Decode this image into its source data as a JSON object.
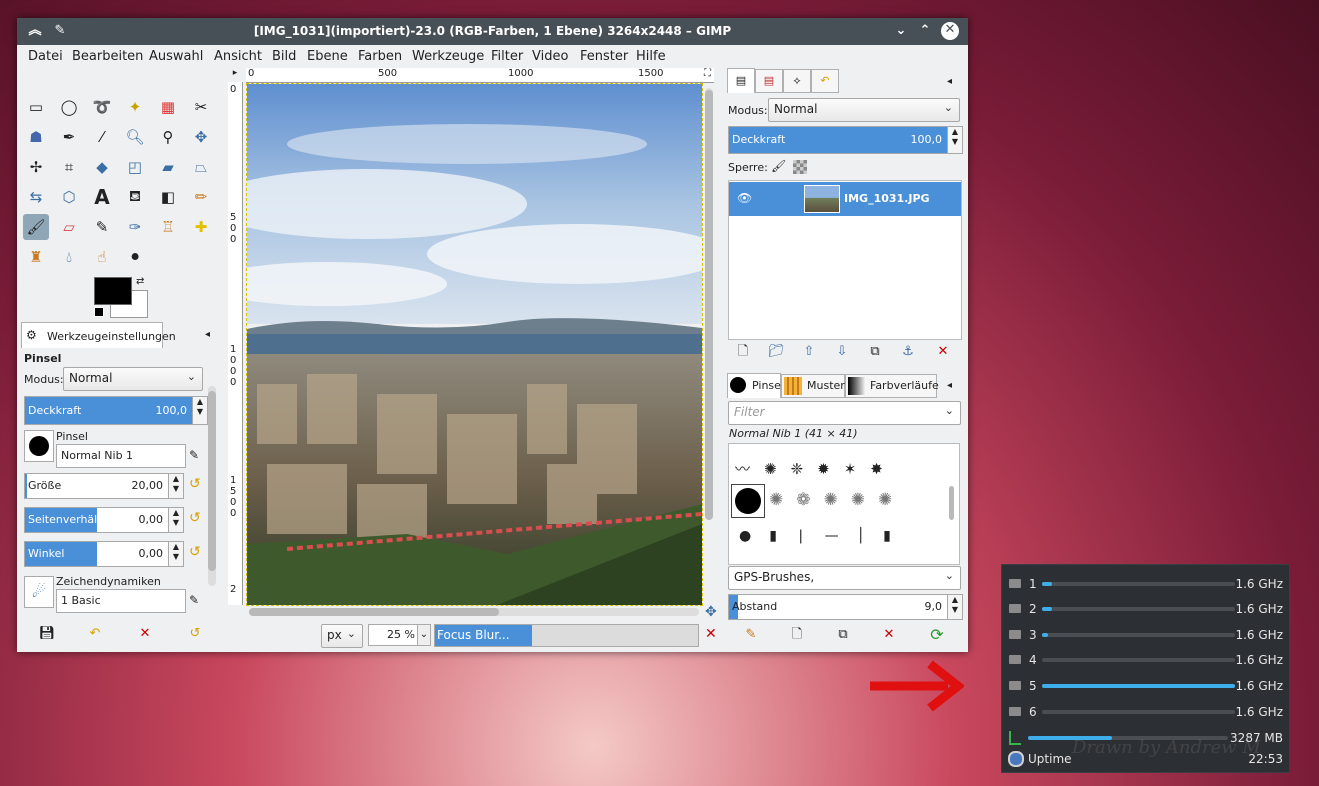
{
  "window": {
    "title": "[IMG_1031](importiert)-23.0 (RGB-Farben, 1 Ebene) 3264x2448 – GIMP"
  },
  "menu": [
    "Datei",
    "Bearbeiten",
    "Auswahl",
    "Ansicht",
    "Bild",
    "Ebene",
    "Farben",
    "Werkzeuge",
    "Filter",
    "Video",
    "Fenster",
    "Hilfe"
  ],
  "tool_options": {
    "tab_label": "Werkzeugeinstellungen",
    "tool_name": "Pinsel",
    "mode_label": "Modus:",
    "mode_value": "Normal",
    "opacity_label": "Deckkraft",
    "opacity_value": "100,0",
    "brush_label": "Pinsel",
    "brush_value": "Normal Nib 1",
    "size_label": "Größe",
    "size_value": "20,00",
    "aspect_label": "Seitenverhältnis",
    "aspect_value": "0,00",
    "angle_label": "Winkel",
    "angle_value": "0,00",
    "dynamics_label": "Zeichendynamiken",
    "dynamics_value": "1 Basic"
  },
  "rulers": {
    "h_ticks": [
      "0",
      "500",
      "1000",
      "1500"
    ],
    "v_ticks": [
      "0",
      "500",
      "1000",
      "1500",
      "2"
    ]
  },
  "status": {
    "unit": "px",
    "zoom": "25 %",
    "progress_label": "Focus Blur...",
    "progress": 0.37
  },
  "layers": {
    "mode_label": "Modus:",
    "mode_value": "Normal",
    "opacity_label": "Deckkraft",
    "opacity_value": "100,0",
    "lock_label": "Sperre:",
    "layer_name": "IMG_1031.JPG"
  },
  "brushes": {
    "tabs": [
      "Pinsel",
      "Muster",
      "Farbverläufe"
    ],
    "filter_placeholder": "Filter",
    "selected_brush": "Normal Nib 1 (41 × 41)",
    "tag_value": "GPS-Brushes,",
    "spacing_label": "Abstand",
    "spacing_value": "9,0"
  },
  "cpu_widget": {
    "cores": [
      {
        "label": "1",
        "freq": "1.6 GHz",
        "load": 0.05
      },
      {
        "label": "2",
        "freq": "1.6 GHz",
        "load": 0.05
      },
      {
        "label": "3",
        "freq": "1.6 GHz",
        "load": 0.03
      },
      {
        "label": "4",
        "freq": "1.6 GHz",
        "load": 0.0
      },
      {
        "label": "5",
        "freq": "1.6 GHz",
        "load": 1.0
      },
      {
        "label": "6",
        "freq": "1.6 GHz",
        "load": 0.0
      }
    ],
    "memory": {
      "value": "3287 MB",
      "load": 0.42
    },
    "uptime_label": "Uptime",
    "uptime_value": "22:53"
  },
  "watermark": "Drawn by Andrew M",
  "colors": {
    "accent": "#4a90d9",
    "titlebar": "#475057",
    "widget_bar": "#3daee9",
    "arrow": "#e01010"
  }
}
